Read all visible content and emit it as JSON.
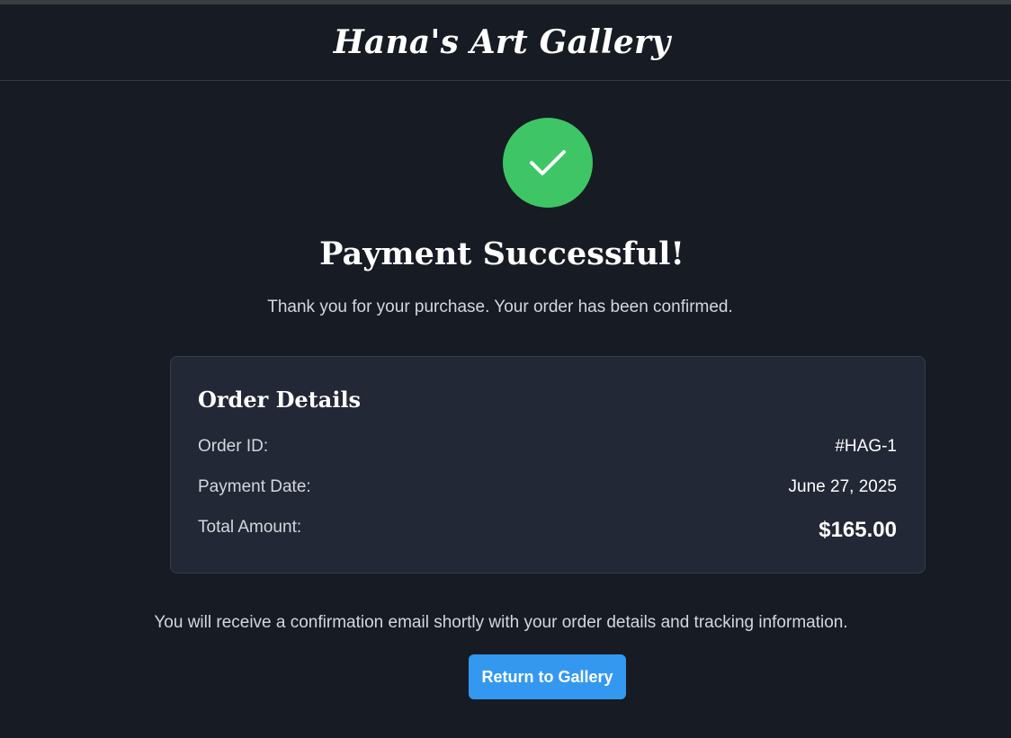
{
  "header": {
    "brand": "Hana's Art Gallery"
  },
  "status": {
    "icon": "check-icon",
    "accent_color": "#3ec666",
    "title": "Payment Successful!",
    "subtitle": "Thank you for your purchase. Your order has been confirmed."
  },
  "order": {
    "heading": "Order Details",
    "rows": [
      {
        "label": "Order ID:",
        "value": "#HAG-1"
      },
      {
        "label": "Payment Date:",
        "value": "June 27, 2025"
      },
      {
        "label": "Total Amount:",
        "value": "$165.00"
      }
    ]
  },
  "footer": {
    "note": "You will receive a confirmation email shortly with your order details and tracking information.",
    "button_label": "Return to Gallery",
    "button_color": "#3498f0"
  }
}
